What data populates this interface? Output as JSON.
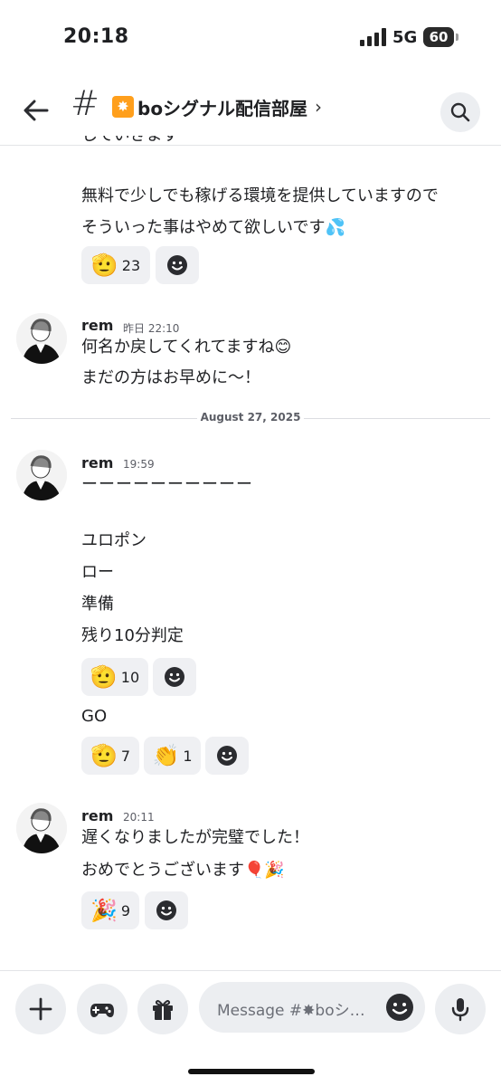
{
  "status_bar": {
    "time": "20:18",
    "network": "5G",
    "battery": "60"
  },
  "header": {
    "hash": "#",
    "channel_emoji": "✸",
    "channel_name": "boシグナル配信部屋",
    "chevron": "›"
  },
  "messages_top": {
    "partial_line": "していきます",
    "line1": "無料で少しでも稼げる環境を提供していますので",
    "line2": "そういった事はやめて欲しいです💦",
    "reaction": {
      "emoji": "🫡",
      "count": "23"
    }
  },
  "msg_1": {
    "user": "rem",
    "time": "昨日 22:10",
    "line1": "何名か戻してくれてますね😊",
    "line2": "まだの方はお早めに〜！"
  },
  "date_divider": "August 27, 2025",
  "msg_2": {
    "user": "rem",
    "time": "19:59",
    "lines": [
      "ーーーーーーーーーー",
      "ユロポン",
      "ロー",
      "準備",
      "残り10分判定"
    ],
    "reaction": {
      "emoji": "🫡",
      "count": "10"
    },
    "go": "GO",
    "go_reactions": [
      {
        "emoji": "🫡",
        "count": "7"
      },
      {
        "emoji": "👏",
        "count": "1"
      }
    ]
  },
  "msg_3": {
    "user": "rem",
    "time": "20:11",
    "line1": "遅くなりましたが完璧でした！",
    "line2": "おめでとうございます🎈🎉",
    "reaction": {
      "emoji": "🎉",
      "count": "9"
    }
  },
  "composer": {
    "placeholder": "Message #✸boシ…"
  },
  "colors": {
    "accent_orange": "#ff9f1c",
    "pill_bg": "#eff0f3",
    "icon_dark": "#2b2c30"
  }
}
